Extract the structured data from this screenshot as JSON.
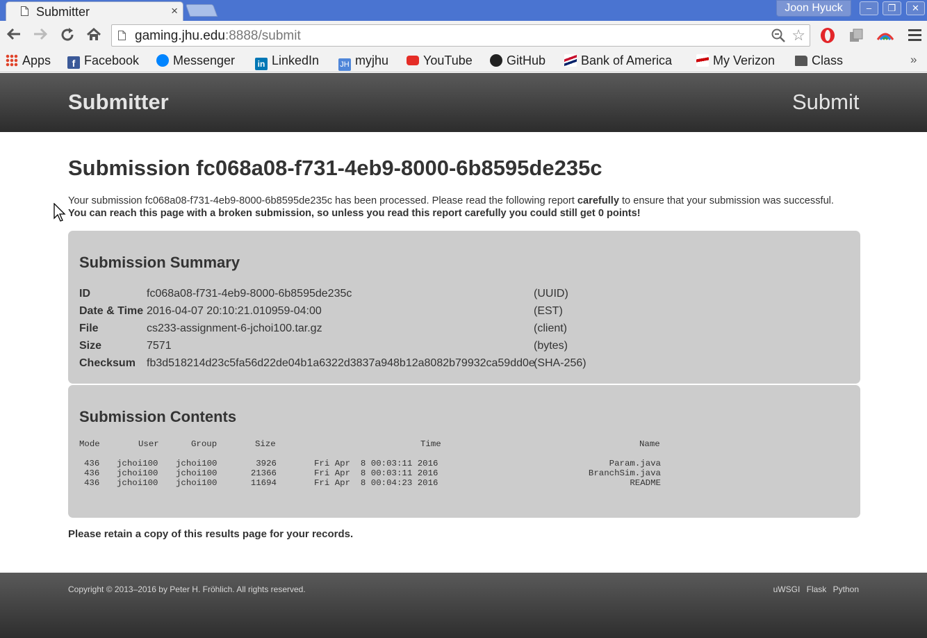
{
  "browser": {
    "tab_title": "Submitter",
    "tab_close": "×",
    "profile_name": "Joon Hyuck",
    "url_host": "gaming.jhu.edu",
    "url_rest": ":8888/submit",
    "window_controls": [
      "–",
      "❐",
      "✕"
    ],
    "bookmarks": [
      {
        "label": "Apps",
        "icon": "apps-grid-icon",
        "color": "#e0432a"
      },
      {
        "label": "Facebook",
        "icon": "facebook-icon",
        "color": "#3b5998"
      },
      {
        "label": "Messenger",
        "icon": "messenger-icon",
        "color": "#0084ff"
      },
      {
        "label": "LinkedIn",
        "icon": "linkedin-icon",
        "color": "#0077b5"
      },
      {
        "label": "myjhu",
        "icon": "myjhu-icon",
        "color": "#4f86d9"
      },
      {
        "label": "YouTube",
        "icon": "youtube-icon",
        "color": "#e52d27"
      },
      {
        "label": "GitHub",
        "icon": "github-icon",
        "color": "#222222"
      },
      {
        "label": "Bank of America",
        "icon": "bank-of-america-icon",
        "color": "#c8102e"
      },
      {
        "label": "My Verizon",
        "icon": "verizon-icon",
        "color": "#cd040b"
      },
      {
        "label": "Class",
        "icon": "folder-icon",
        "color": "#555555"
      }
    ],
    "overflow": "»"
  },
  "header": {
    "brand": "Submitter",
    "nav_submit": "Submit"
  },
  "submission": {
    "title": "Submission fc068a08-f731-4eb9-8000-6b8595de235c",
    "intro_part1": "Your submission fc068a08-f731-4eb9-8000-6b8595de235c has been processed. Please read the following report ",
    "intro_bold1": "carefully",
    "intro_part2": " to ensure that your submission was successful. ",
    "intro_bold2": "You can reach this page with a broken submission, so unless you read this report carefully you could still get 0 points!"
  },
  "summary": {
    "heading": "Submission Summary",
    "rows": [
      {
        "key": "ID",
        "value": "fc068a08-f731-4eb9-8000-6b8595de235c",
        "unit": "(UUID)"
      },
      {
        "key": "Date & Time",
        "value": "2016-04-07 20:10:21.010959-04:00",
        "unit": "(EST)"
      },
      {
        "key": "File",
        "value": "cs233-assignment-6-jchoi100.tar.gz",
        "unit": "(client)"
      },
      {
        "key": "Size",
        "value": "7571",
        "unit": "(bytes)"
      },
      {
        "key": "Checksum",
        "value": "fb3d518214d23c5fa56d22de04b1a6322d3837a948b12a8082b79932ca59dd0e",
        "unit": "(SHA-256)"
      }
    ]
  },
  "contents": {
    "heading": "Submission Contents",
    "columns": [
      "Mode",
      "User",
      "Group",
      "Size",
      "Time",
      "Name"
    ],
    "rows": [
      [
        "436",
        "jchoi100",
        "jchoi100",
        "3926",
        "Fri Apr  8 00:03:11 2016",
        "Param.java"
      ],
      [
        "436",
        "jchoi100",
        "jchoi100",
        "21366",
        "Fri Apr  8 00:03:11 2016",
        "BranchSim.java"
      ],
      [
        "436",
        "jchoi100",
        "jchoi100",
        "11694",
        "Fri Apr  8 00:04:23 2016",
        "README"
      ]
    ]
  },
  "retain_note": "Please retain a copy of this results page for your records.",
  "footer": {
    "copyright": "Copyright © 2013–2016 by Peter H. Fröhlich. All rights reserved.",
    "links": [
      "uWSGI",
      "Flask",
      "Python"
    ]
  }
}
